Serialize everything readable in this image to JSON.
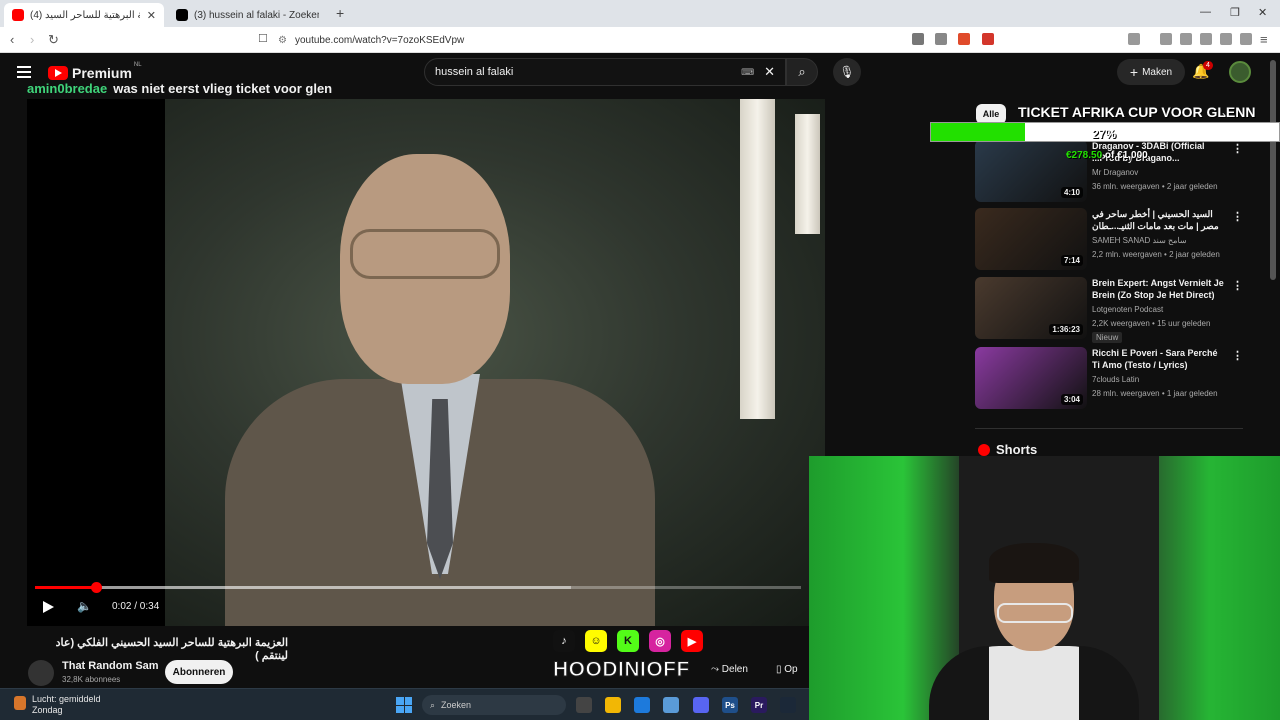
{
  "browser": {
    "tabs": [
      {
        "title": "(4) العزيمة البرهتية للساحر السيد",
        "active": true,
        "favicon_color": "#ff0000"
      },
      {
        "title": "(3) hussein al falaki - Zoeken / X",
        "active": false,
        "favicon_color": "#000000"
      }
    ],
    "new_tab": "+",
    "url": "youtube.com/watch?v=7ozoKSEdVpw"
  },
  "youtube": {
    "logo_text": "Premium",
    "logo_region": "NL",
    "search_value": "hussein al falaki",
    "create_label": "Maken",
    "notification_count": "4"
  },
  "chat": {
    "user": "amin0bredae",
    "message": "was niet eerst vlieg ticket voor glen"
  },
  "player": {
    "time": "0:02 / 0:34",
    "progress_fraction": 0.08,
    "buffered_fraction": 0.7
  },
  "video": {
    "title": "العزيمة البرهتية للساحر السيد الحسيني الفلكي (عاد لينتقم )",
    "channel": "That Random Sam",
    "subscribers": "32,8K abonnees",
    "subscribe_label": "Abonneren",
    "share_label": "Delen",
    "save_label": "Op"
  },
  "overlay": {
    "goal_title": "TICKET AFRIKA CUP VOOR GLENN",
    "goal_percent": "27%",
    "goal_fraction": 0.27,
    "goal_amount_current": "€278.50",
    "goal_amount_target": "€1,000",
    "handle": "HOODINIOFF"
  },
  "sidebar": {
    "chip_all": "Alle",
    "recommendations": [
      {
        "title": "Draganov - 3DABi (Official ...Prod by Dragano...",
        "channel": "Mr Draganov",
        "meta": "36 mln. weergaven • 2 jaar geleden",
        "duration": "4:10",
        "thumb": "#2a3a4a",
        "new": ""
      },
      {
        "title": "السيد الحسيني | أخطر ساحر في مصر | مات بعد مامات الثنيـ...ـطان",
        "channel": "SAMEH SANAD سامح سند",
        "meta": "2,2 mln. weergaven • 2 jaar geleden",
        "duration": "7:14",
        "thumb": "#3a2a1e",
        "new": ""
      },
      {
        "title": "Brein Expert: Angst Vernielt Je Brein (Zo Stop Je Het Direct)",
        "channel": "Lotgenoten Podcast",
        "meta": "2,2K weergaven • 15 uur geleden",
        "duration": "1:36:23",
        "thumb": "#4a3a2e",
        "new": "Nieuw"
      },
      {
        "title": "Ricchi E Poveri - Sara Perché Ti Amo (Testo / Lyrics)",
        "channel": "7clouds Latin",
        "meta": "28 mln. weergaven • 1 jaar geleden",
        "duration": "3:04",
        "thumb": "#8a3aa0",
        "new": ""
      }
    ],
    "shorts_label": "Shorts"
  },
  "taskbar": {
    "weather_line1": "Lucht: gemiddeld",
    "weather_line2": "Zondag",
    "search_placeholder": "Zoeken"
  }
}
